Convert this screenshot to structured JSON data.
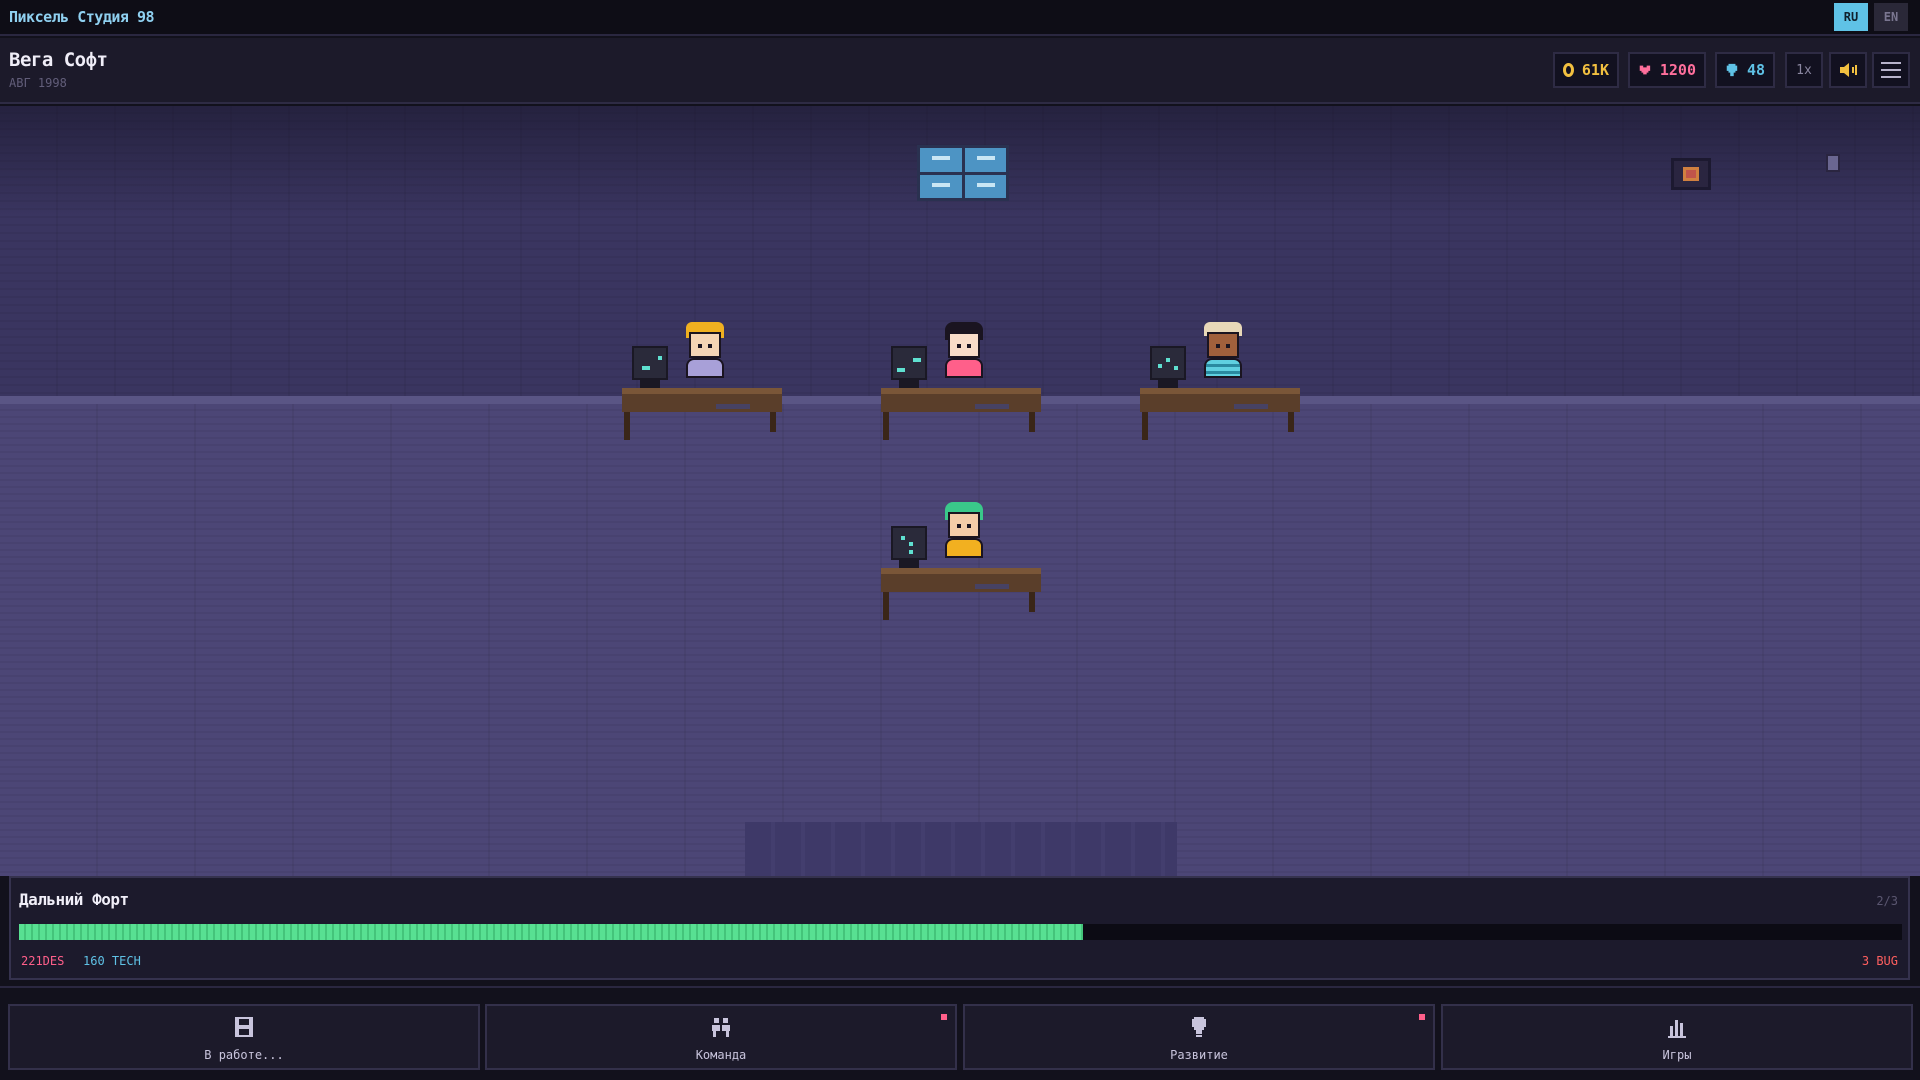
{
  "app": {
    "title": "Пиксель Студия 98"
  },
  "languages": {
    "ru": "RU",
    "en": "EN",
    "active": "RU"
  },
  "studio": {
    "name": "Вега Софт",
    "date": "АВГ 1998"
  },
  "resources": {
    "money": {
      "value": "61K",
      "icon": "coin-icon",
      "color": "#f2c040"
    },
    "hype": {
      "value": "1200",
      "icon": "heart-icon",
      "color": "#ff6f9c"
    },
    "ideas": {
      "value": "48",
      "icon": "bulb-icon",
      "color": "#5fc2e6"
    }
  },
  "controls": {
    "speed": "1x",
    "sound_icon": "speaker-icon",
    "menu_icon": "hamburger-menu-icon"
  },
  "project": {
    "name": "Дальний Форт",
    "stage": "2/3",
    "progress": 0.565,
    "design": "221DES",
    "tech": "160 TECH",
    "bugs": "3 BUG",
    "progress_color": "#58e092"
  },
  "nav": [
    {
      "label": "В работе...",
      "icon": "floppy-disk-icon",
      "badge": false
    },
    {
      "label": "Команда",
      "icon": "team-icon",
      "badge": true
    },
    {
      "label": "Развитие",
      "icon": "bulb-icon",
      "badge": true
    },
    {
      "label": "Игры",
      "icon": "bar-chart-icon",
      "badge": false
    }
  ]
}
